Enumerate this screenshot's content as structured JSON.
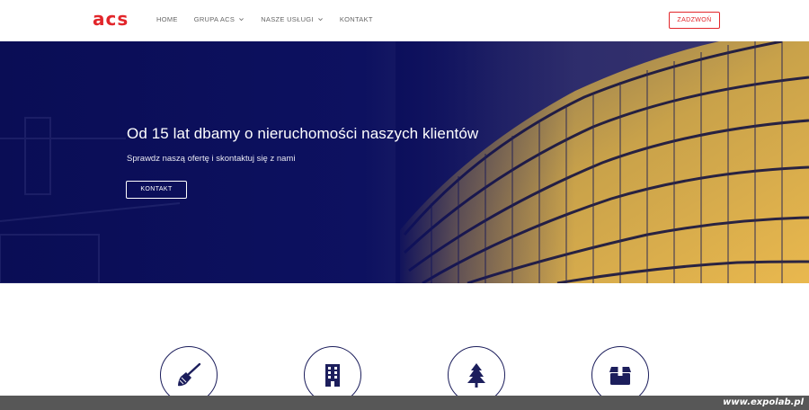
{
  "header": {
    "logo": "acs",
    "nav": [
      {
        "label": "HOME",
        "has_dropdown": false
      },
      {
        "label": "GRUPA ACS",
        "has_dropdown": true
      },
      {
        "label": "NASZE USŁUGI",
        "has_dropdown": true
      },
      {
        "label": "KONTAKT",
        "has_dropdown": false
      }
    ],
    "call_label": "ZADZWOŃ"
  },
  "hero": {
    "title": "Od 15 lat dbamy o nieruchomości naszych klientów",
    "subtitle": "Sprawdz naszą ofertę i skontaktuj się z nami",
    "button_label": "KONTAKT"
  },
  "features": {
    "icons": [
      "broom-icon",
      "building-icon",
      "tree-icon",
      "box-icon"
    ]
  },
  "watermark": "www.expolab.pl",
  "colors": {
    "brand_red": "#e2262b",
    "navy": "#1c1e5c",
    "hero_overlay": "#0c0f5c"
  }
}
